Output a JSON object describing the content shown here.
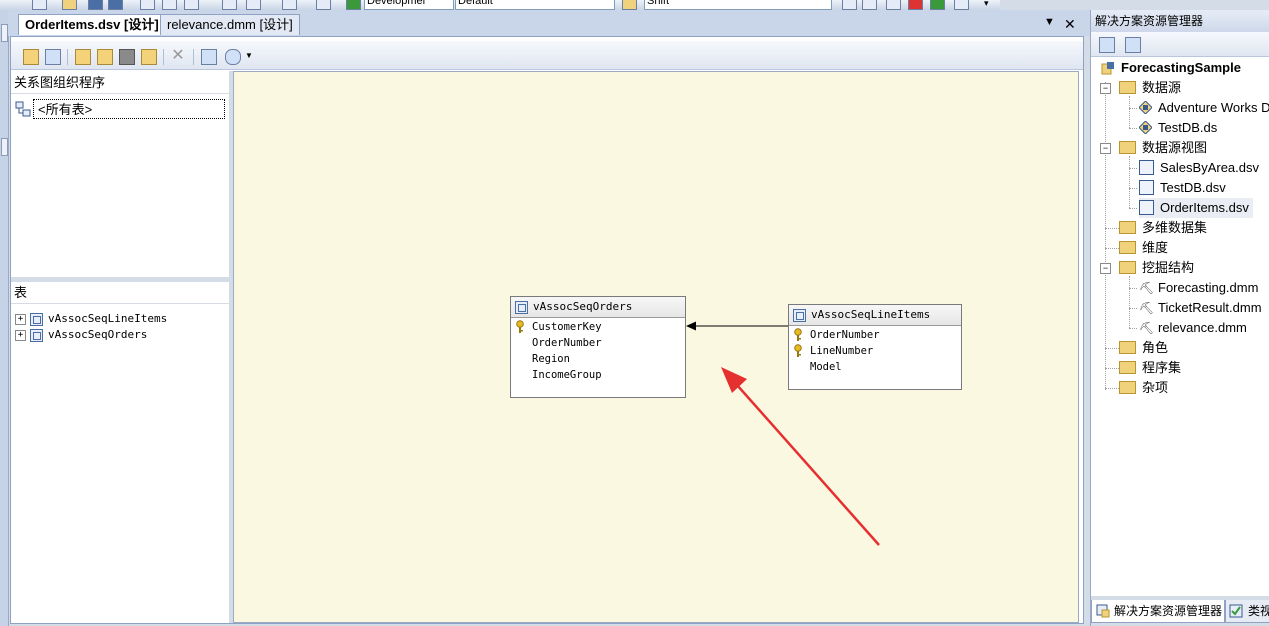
{
  "top_toolbar": {
    "solution_config": "Developmer",
    "platform": "Default",
    "find_box": "Shift"
  },
  "tabs": [
    {
      "label": "OrderItems.dsv [设计]",
      "active": true
    },
    {
      "label": "relevance.dmm [设计]",
      "active": false
    }
  ],
  "left_panel": {
    "organizer_header": "关系图组织程序",
    "organizer_item": "<所有表>",
    "tables_header": "表",
    "tables": [
      "vAssocSeqLineItems",
      "vAssocSeqOrders"
    ]
  },
  "diagram": {
    "orders_table": {
      "title": "vAssocSeqOrders",
      "columns": [
        {
          "name": "CustomerKey",
          "key": true
        },
        {
          "name": "OrderNumber",
          "key": false
        },
        {
          "name": "Region",
          "key": false
        },
        {
          "name": "IncomeGroup",
          "key": false
        }
      ]
    },
    "lineitems_table": {
      "title": "vAssocSeqLineItems",
      "columns": [
        {
          "name": "OrderNumber",
          "key": true
        },
        {
          "name": "LineNumber",
          "key": true
        },
        {
          "name": "Model",
          "key": false
        }
      ]
    }
  },
  "solution_explorer": {
    "title": "解决方案资源管理器",
    "project": "ForecastingSample",
    "folders": {
      "data_sources": "数据源",
      "data_source_views": "数据源视图",
      "cubes": "多维数据集",
      "dimensions": "维度",
      "mining_structures": "挖掘结构",
      "roles": "角色",
      "assemblies": "程序集",
      "misc": "杂项"
    },
    "data_sources": [
      "Adventure Works DW",
      "TestDB.ds"
    ],
    "data_source_views": [
      "SalesByArea.dsv",
      "TestDB.dsv",
      "OrderItems.dsv"
    ],
    "mining_structures": [
      "Forecasting.dmm",
      "TicketResult.dmm",
      "relevance.dmm"
    ],
    "bottom_tabs": [
      "解决方案资源管理器",
      "类视图"
    ]
  },
  "colors": {
    "canvas_bg": "#fbf8e2",
    "annotation_arrow": "#e53030",
    "accent_blue": "#385a8f"
  }
}
